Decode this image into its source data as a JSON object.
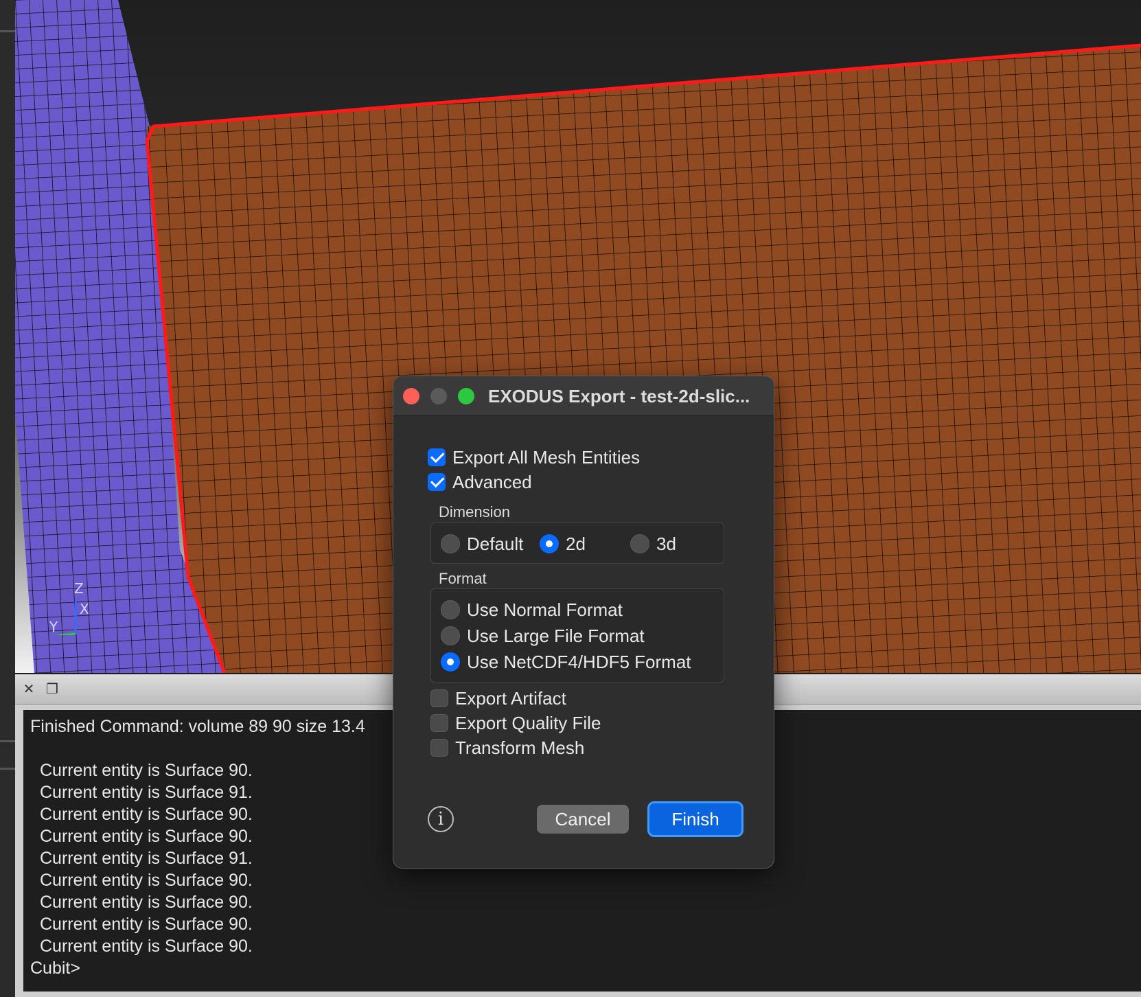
{
  "dialog": {
    "title": "EXODUS Export - test-2d-slic...",
    "export_all_mesh_entities": {
      "label": "Export All Mesh Entities",
      "checked": true
    },
    "advanced": {
      "label": "Advanced",
      "checked": true
    },
    "dimension": {
      "label": "Dimension",
      "options": [
        {
          "label": "Default",
          "selected": false
        },
        {
          "label": "2d",
          "selected": true
        },
        {
          "label": "3d",
          "selected": false
        }
      ]
    },
    "format": {
      "label": "Format",
      "options": [
        {
          "label": "Use Normal Format",
          "selected": false
        },
        {
          "label": "Use Large File Format",
          "selected": false
        },
        {
          "label": "Use NetCDF4/HDF5 Format",
          "selected": true
        }
      ]
    },
    "export_artifact": {
      "label": "Export Artifact",
      "checked": false
    },
    "export_quality_file": {
      "label": "Export Quality File",
      "checked": false
    },
    "transform_mesh": {
      "label": "Transform Mesh",
      "checked": false
    },
    "info_symbol": "i",
    "cancel_label": "Cancel",
    "finish_label": "Finish"
  },
  "triad": {
    "z": "Z",
    "x": "X",
    "y": "Y"
  },
  "console": {
    "first_line": "Finished Command: volume 89 90 size 13.4",
    "lines": [
      "Current entity is Surface 90.",
      "Current entity is Surface 91.",
      "Current entity is Surface 90.",
      "Current entity is Surface 90.",
      "Current entity is Surface 91.",
      "Current entity is Surface 90.",
      "Current entity is Surface 90.",
      "Current entity is Surface 90.",
      "Current entity is Surface 90."
    ],
    "prompt": "Cubit>"
  },
  "colors": {
    "mesh_orange": "#8f4a22",
    "mesh_purple": "#6a5acd",
    "selection_red": "#ff1a1a",
    "accent_blue": "#0a6cff"
  }
}
